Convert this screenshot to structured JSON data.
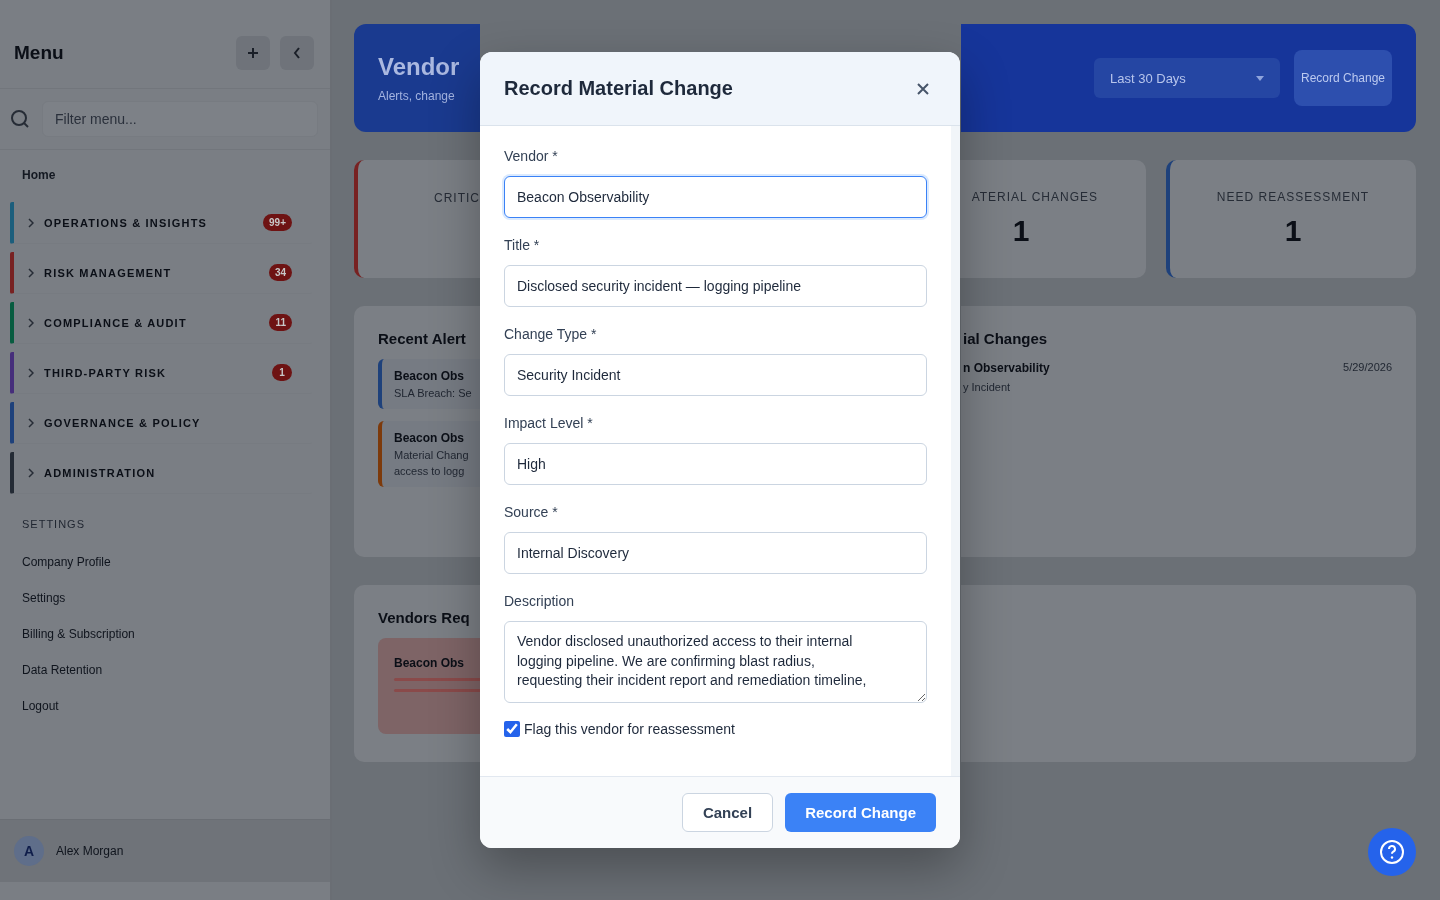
{
  "sidebar": {
    "title": "Menu",
    "filter": {
      "placeholder": "Filter menu..."
    },
    "home": "Home",
    "groups": [
      {
        "label": "OPERATIONS & INSIGHTS",
        "badge": "99+",
        "color": "#1c5e7c"
      },
      {
        "label": "RISK MANAGEMENT",
        "badge": "34",
        "color": "#782222"
      },
      {
        "label": "COMPLIANCE & AUDIT",
        "badge": "11",
        "color": "#085c40"
      },
      {
        "label": "THIRD-PARTY RISK",
        "badge": "1",
        "color": "#462e7b"
      },
      {
        "label": "GOVERNANCE & POLICY",
        "color": "#1e417b"
      },
      {
        "label": "ADMINISTRATION",
        "color": "#242b35"
      }
    ],
    "settings_heading": "SETTINGS",
    "settings_items": [
      "Company Profile",
      "Settings",
      "Billing & Subscription",
      "Data Retention",
      "Logout"
    ],
    "user": {
      "initial": "A",
      "name": "Alex Morgan"
    }
  },
  "header": {
    "title": "Vendor",
    "subtitle": "Alerts, change",
    "range": "Last 30 Days",
    "button": "Record Change"
  },
  "stats": [
    {
      "label": "CRITIC",
      "color": "#782222"
    },
    {
      "label": "ATERIAL CHANGES",
      "value": "1"
    },
    {
      "label": "NEED REASSESSMENT",
      "value": "1",
      "color": "#1e417b"
    }
  ],
  "recent_alerts": {
    "title": "Recent Alert",
    "items": [
      {
        "vendor": "Beacon Obs",
        "text": "SLA Breach: Se",
        "color": "#1e417b"
      },
      {
        "vendor": "Beacon Obs",
        "text": "Material Chang",
        "text2": "access to logg",
        "color": "#7d3a0b"
      }
    ]
  },
  "material_changes": {
    "title": "ial Changes",
    "items": [
      {
        "vendor": "n Observability",
        "type": "y Incident",
        "date": "5/29/2026"
      }
    ]
  },
  "vendors_requiring": {
    "title": "Vendors Req",
    "items": [
      {
        "vendor": "Beacon Obs"
      }
    ]
  },
  "modal": {
    "title": "Record Material Change",
    "fields": [
      {
        "label": "Vendor *",
        "value": "Beacon Observability",
        "focused": true
      },
      {
        "label": "Title *",
        "value": "Disclosed security incident — logging pipeline",
        "focused": false
      },
      {
        "label": "Change Type *",
        "value": "Security Incident",
        "focused": false
      },
      {
        "label": "Impact Level *",
        "value": "High",
        "focused": false
      },
      {
        "label": "Source *",
        "value": "Internal Discovery",
        "focused": false
      }
    ],
    "description": {
      "label": "Description",
      "value": "Vendor disclosed unauthorized access to their internal\nlogging pipeline. We are confirming blast radius,\nrequesting their incident report and remediation timeline,"
    },
    "flag": {
      "label": "Flag this vendor for reassessment",
      "checked": true
    },
    "buttons": [
      {
        "label": "Cancel",
        "kind": "secondary"
      },
      {
        "label": "Record Change",
        "kind": "primary"
      }
    ]
  }
}
